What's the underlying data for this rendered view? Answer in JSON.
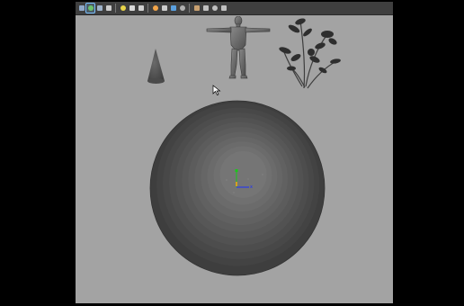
{
  "viewport": {
    "background_color": "#a3a3a3",
    "letterbox_color": "#000000",
    "toolbar_color": "#3f3f3f"
  },
  "toolbar": {
    "buttons": [
      {
        "icon": "camera-attributes-icon",
        "color": "#8fa8c8",
        "active": false
      },
      {
        "icon": "image-plane-icon",
        "color": "#6cc26c",
        "active": true
      },
      {
        "icon": "grid-icon",
        "color": "#9db2c9",
        "active": false
      },
      {
        "icon": "wireframe-icon",
        "color": "#cccccc",
        "active": false
      },
      {
        "icon": "smooth-shade-icon",
        "color": "#e8d44a",
        "active": false
      },
      {
        "icon": "default-material-icon",
        "color": "#d9d9d9",
        "active": false
      },
      {
        "icon": "textured-icon",
        "color": "#d0d0d0",
        "active": false
      },
      {
        "icon": "lights-icon",
        "color": "#f2a54a",
        "active": false
      },
      {
        "icon": "shadows-icon",
        "color": "#cccccc",
        "active": false
      },
      {
        "icon": "ambient-occlusion-icon",
        "color": "#5aa0e0",
        "active": false
      },
      {
        "icon": "anti-aliasing-icon",
        "color": "#b0b0b0",
        "active": false
      },
      {
        "icon": "isolate-select-icon",
        "color": "#c8a070",
        "active": false
      },
      {
        "icon": "xray-icon",
        "color": "#c0c0c0",
        "active": false
      },
      {
        "icon": "xray-joints-icon",
        "color": "#c0c0c0",
        "active": false
      },
      {
        "icon": "resolution-gate-icon",
        "color": "#c0c0c0",
        "active": false
      }
    ]
  },
  "scene": {
    "objects": [
      "cone",
      "human-figure",
      "plant",
      "sphere"
    ],
    "axis_label": "x",
    "axis_colors": {
      "x": "#1a2eff",
      "y": "#19c819",
      "z": "#1a2eff"
    }
  }
}
